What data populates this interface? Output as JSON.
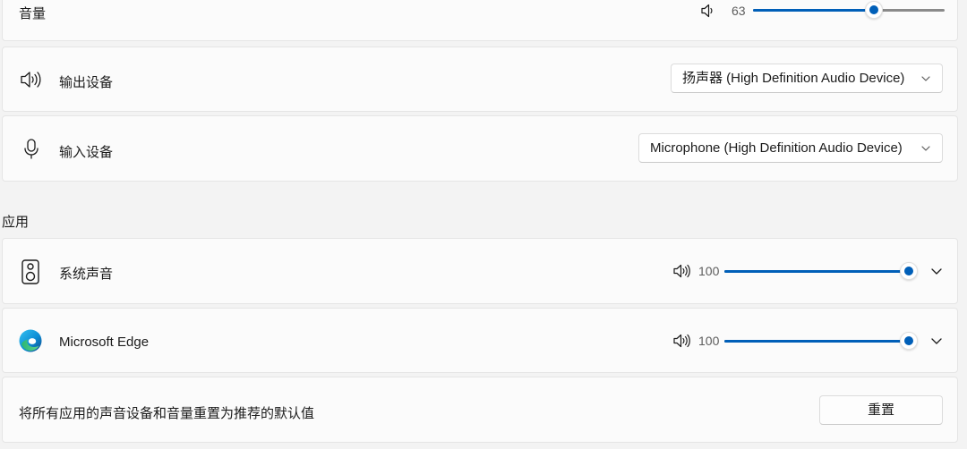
{
  "volume": {
    "label": "音量",
    "value": "63",
    "level": 0.63,
    "icon": "speaker-icon"
  },
  "output": {
    "label": "输出设备",
    "device": "扬声器 (High Definition Audio Device)",
    "icon": "speaker-icon"
  },
  "input": {
    "label": "输入设备",
    "device": "Microphone (High Definition Audio Device)",
    "icon": "microphone-icon"
  },
  "apps": {
    "section_title": "应用",
    "items": [
      {
        "name": "系统声音",
        "value": "100",
        "level": 1.0,
        "icon": "system-sounds-icon"
      },
      {
        "name": "Microsoft Edge",
        "value": "100",
        "level": 1.0,
        "icon": "edge-icon"
      }
    ]
  },
  "reset": {
    "description": "将所有应用的声音设备和音量重置为推荐的默认值",
    "button_label": "重置"
  },
  "colors": {
    "accent": "#005fb8",
    "card_background": "#fbfbfb",
    "page_background": "#f3f3f3"
  }
}
